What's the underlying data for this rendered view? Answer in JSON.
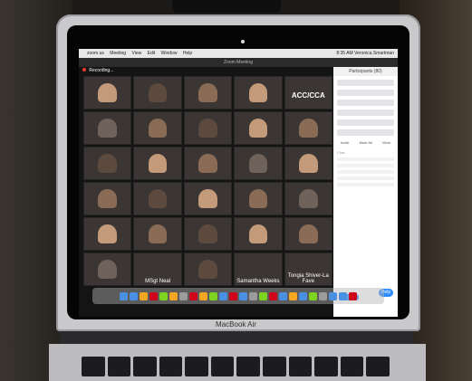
{
  "menu": {
    "apple": "",
    "items": [
      "zoom.us",
      "Meeting",
      "View",
      "Edit",
      "Window",
      "Help"
    ],
    "right": "8:35 AM  Veronica Smartman"
  },
  "window_title": "Zoom Meeting",
  "recording_label": "Recording...",
  "tiles": [
    {
      "label": ""
    },
    {
      "label": ""
    },
    {
      "label": ""
    },
    {
      "label": ""
    },
    {
      "label": "ACC/CCA",
      "center": true
    },
    {
      "label": ""
    },
    {
      "label": ""
    },
    {
      "label": ""
    },
    {
      "label": ""
    },
    {
      "label": ""
    },
    {
      "label": ""
    },
    {
      "label": ""
    },
    {
      "label": ""
    },
    {
      "label": ""
    },
    {
      "label": ""
    },
    {
      "label": ""
    },
    {
      "label": ""
    },
    {
      "label": ""
    },
    {
      "label": ""
    },
    {
      "label": ""
    },
    {
      "label": ""
    },
    {
      "label": ""
    },
    {
      "label": ""
    },
    {
      "label": ""
    },
    {
      "label": ""
    },
    {
      "label": ""
    },
    {
      "label": "MSgt Neal"
    },
    {
      "label": ""
    },
    {
      "label": "Samantha Weeks"
    },
    {
      "label": "Tongia Shiver-La Fave"
    }
  ],
  "sidebar": {
    "participants": "Participants (80)",
    "btn_invite": "Invite",
    "btn_mute": "Mute All",
    "btn_more": "More",
    "chat": "Chat",
    "help": "Help"
  },
  "laptop_label": "MacBook Air"
}
